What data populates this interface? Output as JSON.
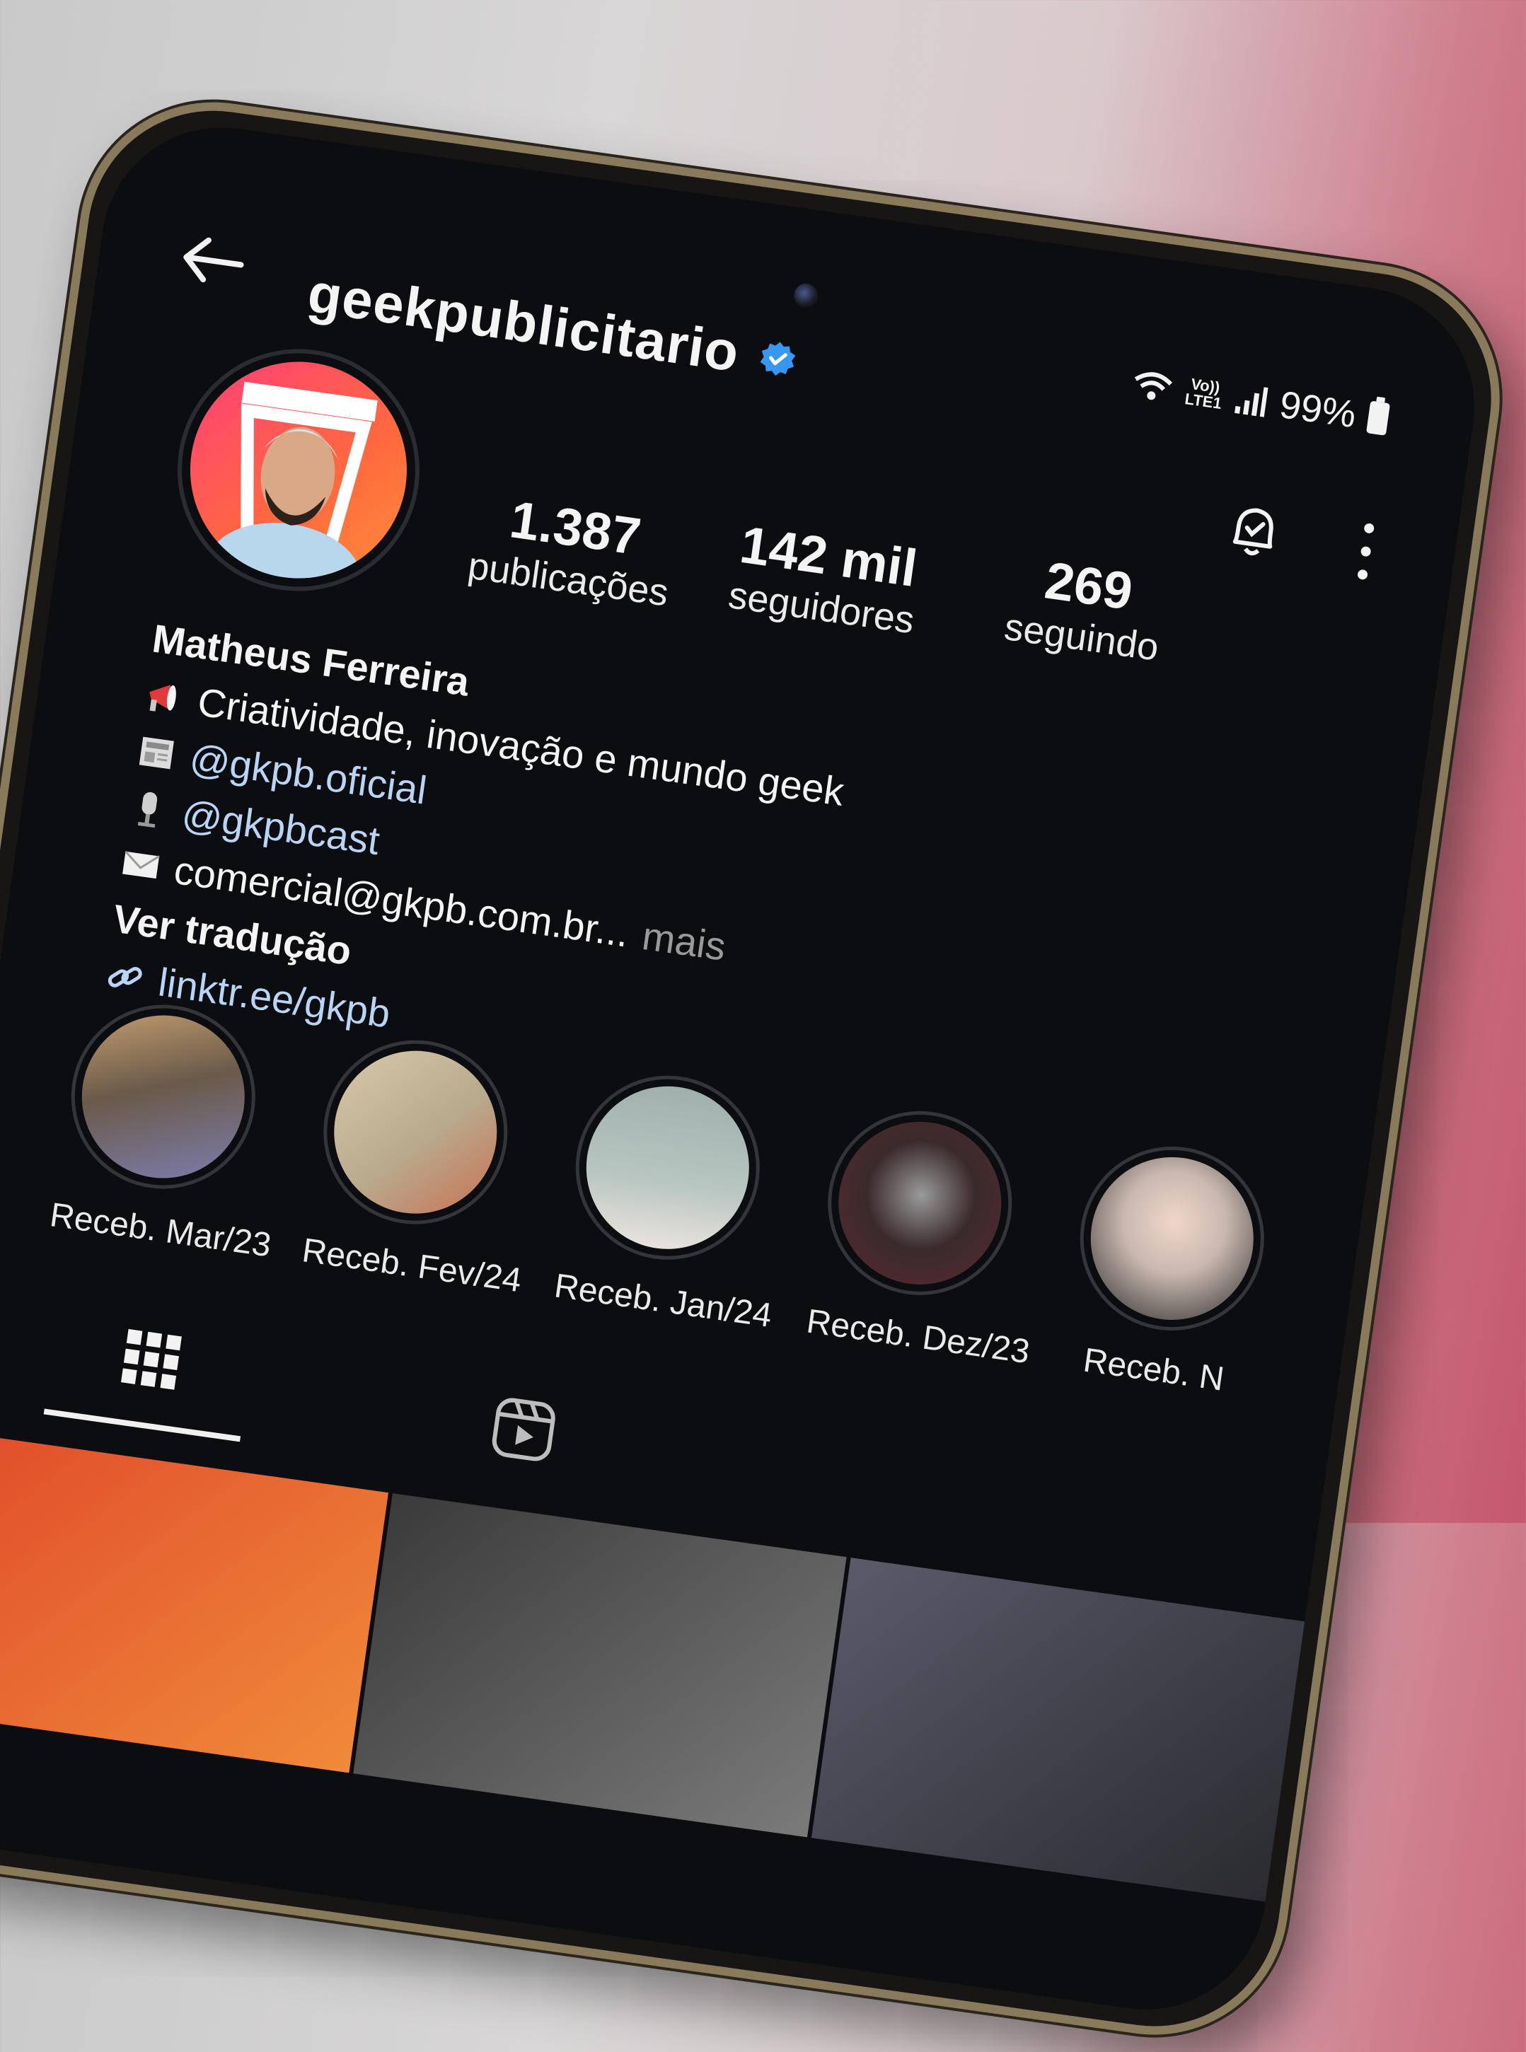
{
  "status_bar": {
    "network_label_top": "Vo))",
    "network_label_bottom": "LTE1",
    "battery_text": "99%"
  },
  "header": {
    "username": "geekpublicitario",
    "verified_icon": "verified-badge-icon",
    "back_icon": "arrow-left-icon",
    "notifications_icon": "bell-icon",
    "options_icon": "kebab-menu-icon"
  },
  "profile": {
    "stats": [
      {
        "value": "1.387",
        "label": "publicações"
      },
      {
        "value": "142 mil",
        "label": "seguidores"
      },
      {
        "value": "269",
        "label": "seguindo"
      }
    ],
    "name": "Matheus Ferreira",
    "bio": {
      "line1": "Criatividade, inovação e mundo geek",
      "line2": "@gkpb.oficial",
      "line3": "@gkpbcast",
      "line4": "comercial@gkpb.com.br...",
      "more": "mais",
      "translate": "Ver tradução",
      "link": "linktr.ee/gkpb"
    }
  },
  "highlights": [
    {
      "label": "Receb. Mar/23",
      "color": "#6a5a4a"
    },
    {
      "label": "Receb. Fev/24",
      "color": "#b9a98c"
    },
    {
      "label": "Receb. Jan/24",
      "color": "#9fb0ac"
    },
    {
      "label": "Receb. Dez/23",
      "color": "#5a2a2e"
    },
    {
      "label": "Receb. N",
      "color": "#c9b8b0"
    }
  ],
  "tabs": {
    "grid_icon": "grid-icon",
    "reels_icon": "reels-icon"
  },
  "colors": {
    "screen_background": "#0b0d10",
    "link_color": "#b9d4f5",
    "verified_blue": "#3897f0"
  }
}
